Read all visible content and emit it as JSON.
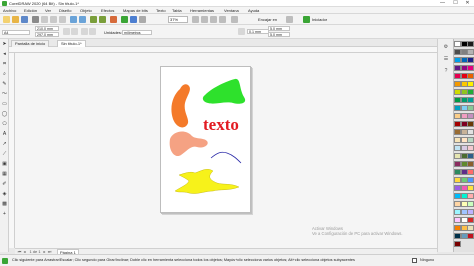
{
  "window": {
    "title": "CorelDRAW 2020 (64 Bit) - Sin título-1*",
    "controls": [
      "—",
      "☐",
      "✕"
    ]
  },
  "menu": [
    "Archivo",
    "Edición",
    "Ver",
    "Diseño",
    "Objeto",
    "Efectos",
    "Mapas de bits",
    "Texto",
    "Tabla",
    "Herramientas",
    "Ventana",
    "Ayuda"
  ],
  "toolbar": {
    "zoom": "37%",
    "snap_label": "Encajar en",
    "launch_label": "Iniciador"
  },
  "propbar": {
    "page_size": "A4",
    "width": "210,0 mm",
    "height": "297,0 mm",
    "units_label": "Unidades:",
    "units_value": "milímetros",
    "nudge": "0,1 mm",
    "dup_x": "5,0 mm",
    "dup_y": "5,0 mm"
  },
  "tabs": [
    {
      "label": "Pantalla de inicio",
      "active": false
    },
    {
      "label": "Sin título-1*",
      "active": true
    }
  ],
  "canvas": {
    "text_object": "texto",
    "colors": {
      "orange": "#f47a2a",
      "green": "#2ee12c",
      "red": "#e21b22",
      "salmon": "#f5a283",
      "yellow": "#f7f21a",
      "curve": "#2a2aa8"
    }
  },
  "watermark": {
    "line1": "Activar Windows",
    "line2": "Ve a Configuración de PC para activar Windows."
  },
  "pagebar": {
    "counter": "1 de 1",
    "page_label": "Página 1"
  },
  "status": {
    "hint": "Clic siguiente para Arrastrar/Escalar; Clic segundo para Girar/Inclinar; Doble clic en herramienta selecciona todos los objetos; Mayús+clic selecciona varios objetos; Alt+clic selecciona objetos subyacentes",
    "fill_label": "Ninguno"
  },
  "palette_colors": [
    "#ffffff",
    "#000000",
    "#1a1a1a",
    "#4d4d4d",
    "#808080",
    "#b3b3b3",
    "#00a0e9",
    "#0068b7",
    "#1d2088",
    "#601986",
    "#920783",
    "#e4007f",
    "#e5004f",
    "#e60012",
    "#eb6100",
    "#f39800",
    "#fcc800",
    "#fff100",
    "#cfdb00",
    "#8fc31f",
    "#22ac38",
    "#009944",
    "#009b6b",
    "#009e96",
    "#00a0c1",
    "#7fcef4",
    "#89c997",
    "#facd89",
    "#f19ec2",
    "#c490bf",
    "#a40000",
    "#7d0022",
    "#6a3906",
    "#996c33",
    "#c7b299",
    "#e1e1e1",
    "#f7e4b8",
    "#ffe4c4",
    "#b7d7c2",
    "#c0e4f5",
    "#d8cbe4",
    "#f3c9d0",
    "#e5e5b1",
    "#4a6c2f",
    "#2c5f8a",
    "#8a2c5f",
    "#5f8a2c",
    "#8a5f2c",
    "#2c8a5f",
    "#5f2c8a",
    "#ff6b6b",
    "#ffd93d",
    "#6bcb77",
    "#4d96ff",
    "#9b5de5",
    "#f15bb5",
    "#fee440",
    "#00bbf9",
    "#00f5d4",
    "#ffadad",
    "#ffd6a5",
    "#fdffb6",
    "#caffbf",
    "#9bf6ff",
    "#a0c4ff",
    "#bdb2ff",
    "#ffc6ff",
    "#fffffc",
    "#d62828",
    "#f77f00",
    "#fcbf49",
    "#eae2b7",
    "#003049",
    "#669bbc",
    "#c1121f",
    "#780000"
  ]
}
